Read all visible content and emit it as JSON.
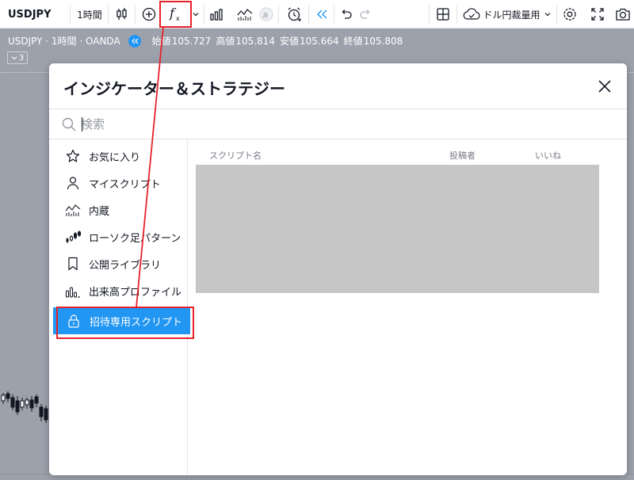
{
  "toolbar": {
    "symbol": "USDJPY",
    "interval": "1時間",
    "currency": "ドル円裁量用"
  },
  "chart": {
    "title": "USDJPY · 1時間 · OANDA",
    "ohlc": [
      {
        "label": "始値",
        "value": "105.727"
      },
      {
        "label": "高値",
        "value": "105.814"
      },
      {
        "label": "安値",
        "value": "105.664"
      },
      {
        "label": "終値",
        "value": "105.808"
      }
    ],
    "indicator_count": "3"
  },
  "dialog": {
    "title": "インジケーター＆ストラテジー",
    "search_placeholder": "検索",
    "sidebar": [
      {
        "label": "お気に入り",
        "icon": "star-icon"
      },
      {
        "label": "マイスクリプト",
        "icon": "user-icon"
      },
      {
        "label": "内蔵",
        "icon": "builtin-chart-icon"
      },
      {
        "label": "ローソク足パターン",
        "icon": "candlestick-icon"
      },
      {
        "label": "公開ライブラリ",
        "icon": "bookmark-icon"
      },
      {
        "label": "出来高プロファイル",
        "icon": "volume-profile-icon"
      },
      {
        "label": "招待専用スクリプト",
        "icon": "lock-icon",
        "active": true
      }
    ],
    "columns": {
      "name": "スクリプト名",
      "author": "投稿者",
      "likes": "いいね"
    }
  },
  "colors": {
    "accent": "#2196f3",
    "highlight": "#e8212a",
    "chart_bg": "#9da1ac"
  }
}
